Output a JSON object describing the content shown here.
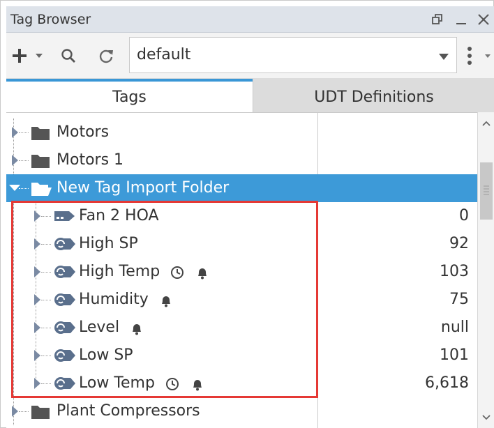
{
  "window": {
    "title": "Tag Browser",
    "restore_icon": "restore-window-icon",
    "minimize_icon": "minimize-icon",
    "close_icon": "close-icon"
  },
  "toolbar": {
    "add_icon": "plus-icon",
    "add_dropdown_icon": "chevron-down-icon",
    "search_icon": "search-icon",
    "refresh_icon": "refresh-icon",
    "provider_value": "default",
    "provider_dropdown_icon": "dropdown-arrow-icon",
    "more_icon": "vertical-ellipsis-icon"
  },
  "tabs": [
    {
      "label": "Tags",
      "active": true
    },
    {
      "label": "UDT Definitions",
      "active": false
    }
  ],
  "tree": {
    "rows": [
      {
        "label": "Motors",
        "type": "folder",
        "value": "",
        "expanded": false,
        "selected": false,
        "level": 0,
        "badges": []
      },
      {
        "label": "Motors 1",
        "type": "folder",
        "value": "",
        "expanded": false,
        "selected": false,
        "level": 0,
        "badges": []
      },
      {
        "label": "New Tag Import Folder",
        "type": "folder",
        "value": "",
        "expanded": true,
        "selected": true,
        "level": 0,
        "badges": []
      },
      {
        "label": "Fan 2 HOA",
        "type": "memory-tag",
        "value": "0",
        "expanded": false,
        "selected": false,
        "level": 1,
        "badges": []
      },
      {
        "label": "High SP",
        "type": "opc-tag",
        "value": "92",
        "expanded": false,
        "selected": false,
        "level": 1,
        "badges": []
      },
      {
        "label": "High Temp",
        "type": "opc-tag",
        "value": "103",
        "expanded": false,
        "selected": false,
        "level": 1,
        "badges": [
          "history-icon",
          "alarm-bell-icon"
        ]
      },
      {
        "label": "Humidity",
        "type": "opc-tag",
        "value": "75",
        "expanded": false,
        "selected": false,
        "level": 1,
        "badges": [
          "alarm-bell-icon"
        ]
      },
      {
        "label": "Level",
        "type": "opc-tag",
        "value": "null",
        "expanded": false,
        "selected": false,
        "level": 1,
        "badges": [
          "alarm-bell-icon"
        ]
      },
      {
        "label": "Low SP",
        "type": "opc-tag",
        "value": "101",
        "expanded": false,
        "selected": false,
        "level": 1,
        "badges": []
      },
      {
        "label": "Low Temp",
        "type": "opc-tag",
        "value": "6,618",
        "expanded": false,
        "selected": false,
        "level": 1,
        "badges": [
          "history-icon",
          "alarm-bell-icon"
        ]
      },
      {
        "label": "Plant Compressors",
        "type": "folder",
        "value": "",
        "expanded": false,
        "selected": false,
        "level": 0,
        "badges": []
      }
    ]
  },
  "colors": {
    "selection": "#3d9ad8",
    "highlight_border": "#e53935",
    "active_tab_accent": "#3a97d6"
  }
}
